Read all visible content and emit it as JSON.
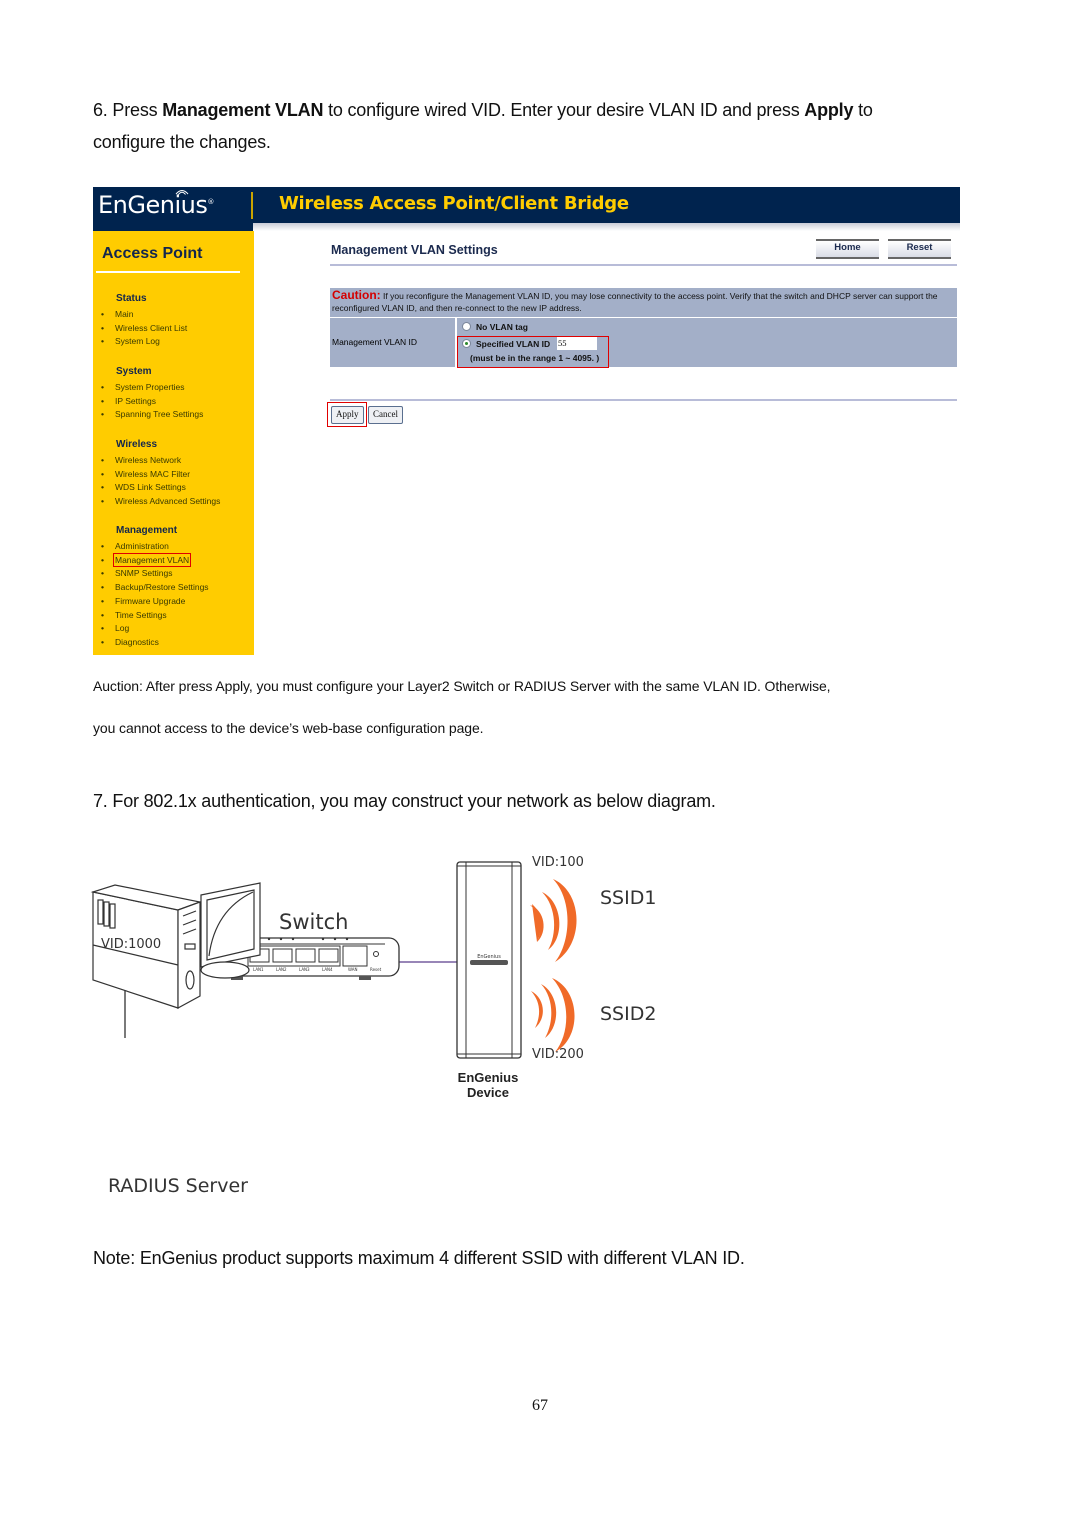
{
  "step6": {
    "prefix": "6. Press ",
    "bold1": "Management VLAN",
    "middle": " to configure wired VID. Enter your desire VLAN ID and press ",
    "bold2": "Apply",
    "suffix": " to",
    "line2": "configure the changes."
  },
  "screenshot": {
    "brand": "EnGenius",
    "brand_mark": "®",
    "app_title": "Wireless Access Point/Client Bridge",
    "sidebar_title": "Access Point",
    "sections": [
      {
        "title": "Status",
        "items": [
          "Main",
          "Wireless Client List",
          "System Log"
        ]
      },
      {
        "title": "System",
        "items": [
          "System Properties",
          "IP Settings",
          "Spanning Tree Settings"
        ]
      },
      {
        "title": "Wireless",
        "items": [
          "Wireless Network",
          "Wireless MAC Filter",
          "WDS Link Settings",
          "Wireless Advanced Settings"
        ]
      },
      {
        "title": "Management",
        "items": [
          "Administration",
          "Management VLAN",
          "SNMP Settings",
          "Backup/Restore Settings",
          "Firmware Upgrade",
          "Time Settings",
          "Log",
          "Diagnostics"
        ]
      }
    ],
    "highlighted_item": "Management VLAN",
    "page_title": "Management VLAN Settings",
    "home_button": "Home",
    "reset_button": "Reset",
    "caution_word": "Caution:",
    "caution_text": " If you reconfigure the Management VLAN ID, you may lose connectivity to the access point. Verify that the switch and DHCP server can support the reconfigured VLAN ID, and then re-connect to the new IP address.",
    "field_label": "Management VLAN ID",
    "option_no_tag": "No VLAN tag",
    "option_specified": "Specified VLAN ID",
    "vlan_id_value": "55",
    "range_hint": "(must be in the range 1 ~ 4095. )",
    "selected_option": "Specified VLAN ID",
    "apply_button": "Apply",
    "cancel_button": "Cancel"
  },
  "auction_note": {
    "line1": "Auction: After press Apply, you must configure your Layer2 Switch or RADIUS Server with the same VLAN ID. Otherwise,",
    "line2": "you cannot access to the device’s web-base configuration page."
  },
  "step7": "7. For 802.1x authentication, you may construct your network as below diagram.",
  "diagram": {
    "switch_label": "Switch",
    "switch_vid": "VID:1000",
    "switch_ports": [
      "DC-IN",
      "LAN1",
      "LAN2",
      "LAN3",
      "LAN4",
      "WAN",
      "Reset"
    ],
    "server_label": "RADIUS Server",
    "device_label_line1": "EnGenius",
    "device_label_line2": "Device",
    "ssid1_label": "SSID1",
    "ssid1_vid": "VID:100",
    "ssid2_label": "SSID2",
    "ssid2_vid": "VID:200",
    "device_logo": "EnGenius",
    "wave_color": "#f06a28",
    "link_color": "#5b3f8c"
  },
  "note": "Note: EnGenius product supports maximum 4 different SSID with different VLAN ID.",
  "page_number": "67"
}
